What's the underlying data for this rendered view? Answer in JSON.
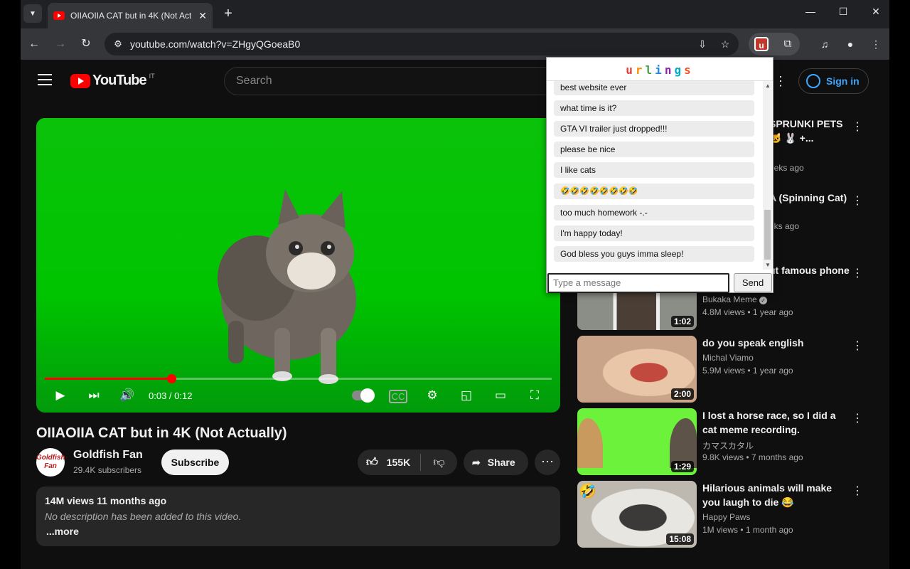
{
  "browser": {
    "tab_title": "OIIAOIIA CAT but in 4K (Not Actually)",
    "url": "youtube.com/watch?v=ZHgyQGoeaB0"
  },
  "header": {
    "logo_text": "YouTube",
    "country": "IT",
    "search_placeholder": "Search",
    "signin_label": "Sign in"
  },
  "player": {
    "time": "0:03 / 0:12",
    "progress_fraction": 0.25
  },
  "video": {
    "title": "OIIAOIIA CAT but in 4K (Not Actually)",
    "channel": "Goldfish Fan",
    "avatar_text": "Goldfish Fan",
    "subscribers": "29.4K subscribers",
    "subscribe_label": "Subscribe",
    "likes": "155K",
    "share_label": "Share",
    "description": {
      "meta": "14M views  11 months ago",
      "text": "No description has been added to this video.",
      "more": "...more"
    }
  },
  "recommendations": [
    {
      "title": "SPRUNKI PETS 🐱 🐰 +...",
      "channel": "",
      "meta": "eeks ago",
      "duration": ""
    },
    {
      "title": "A (Spinning Cat)",
      "channel": "",
      "meta": "eks ago",
      "duration": ""
    },
    {
      "title": "ut famous phone",
      "channel": "Bukaka Meme",
      "meta": "4.8M views  • 1 year ago",
      "duration": "1:02"
    },
    {
      "title": "do you speak english",
      "channel": "Michal Viamo",
      "meta": "5.9M views  • 1 year ago",
      "duration": "2:00"
    },
    {
      "title": "I lost a horse race, so I did a cat meme recording.",
      "channel": "カマスカタル",
      "meta": "9.8K views  • 7 months ago",
      "duration": "1:29"
    },
    {
      "title": "Hilarious animals will make you laugh to die 😂",
      "channel": "Happy Paws",
      "meta": "1M views  • 1 month ago",
      "duration": "15:08"
    }
  ],
  "extension": {
    "brand": "urlings",
    "brand_colors": [
      "#e53935",
      "#fb8c00",
      "#43a047",
      "#1e88e5",
      "#8e24aa",
      "#00acc1",
      "#f4511e"
    ],
    "messages": [
      "best website ever",
      "what time is it?",
      "GTA VI trailer just dropped!!!",
      "please be nice",
      "I like cats",
      "🤣🤣🤣🤣🤣🤣🤣🤣",
      "too much homework -.-",
      "I'm happy today!",
      "God bless you guys imma sleep!"
    ],
    "input_placeholder": "Type a message",
    "send_label": "Send"
  }
}
